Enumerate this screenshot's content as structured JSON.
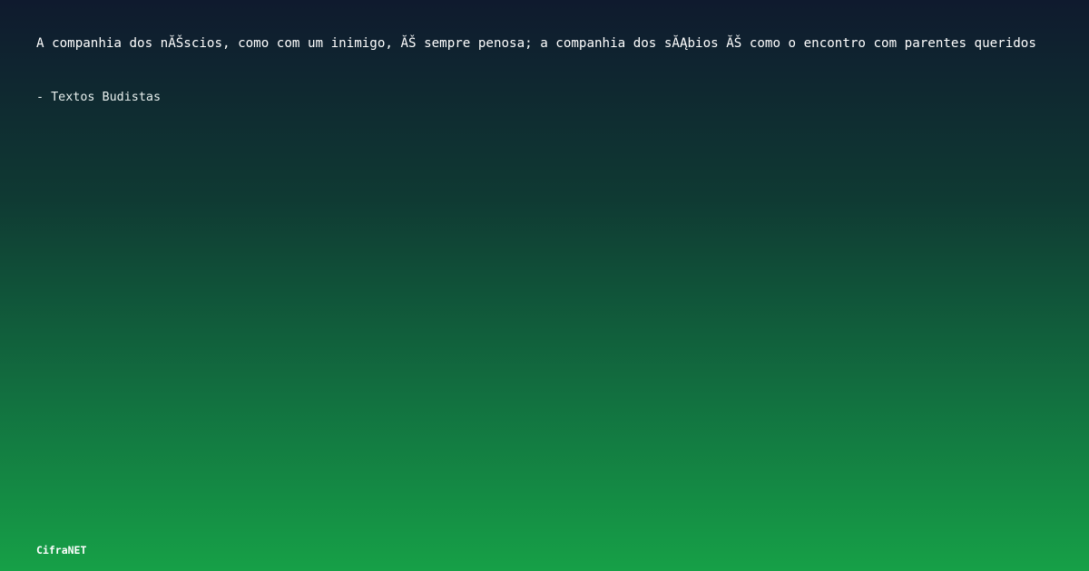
{
  "quote": {
    "text": "A companhia dos nĂŠscios, como com um inimigo, ĂŠ sempre penosa; a companhia dos sĂĄbios ĂŠ como o encontro com parentes queridos"
  },
  "author": {
    "text": "- Textos Budistas"
  },
  "brand": {
    "name": "CifraNET"
  },
  "colors": {
    "gradient_top": "#0f1a2e",
    "gradient_bottom": "#16a047",
    "text": "#ffffff"
  }
}
